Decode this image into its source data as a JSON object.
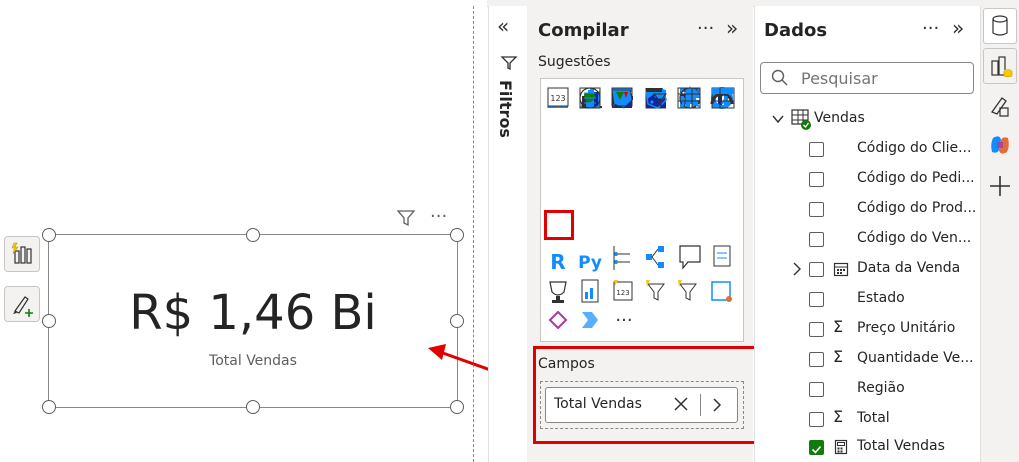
{
  "card": {
    "value": "R$ 1,46 Bi",
    "label": "Total Vendas"
  },
  "filters": {
    "label": "Filtros"
  },
  "build": {
    "title": "Compilar",
    "suggestions_label": "Sugestões",
    "fields_label": "Campos",
    "field_value": "Total Vendas",
    "selected_visual": "card-visual"
  },
  "data_pane": {
    "title": "Dados",
    "search_placeholder": "Pesquisar",
    "table_name": "Vendas",
    "fields": [
      {
        "label": "Código do Clie...",
        "type": "text",
        "checked": false
      },
      {
        "label": "Código do Pedi...",
        "type": "text",
        "checked": false
      },
      {
        "label": "Código do Prod...",
        "type": "text",
        "checked": false
      },
      {
        "label": "Código do Ven...",
        "type": "text",
        "checked": false
      },
      {
        "label": "Data da Venda",
        "type": "date",
        "checked": false
      },
      {
        "label": "Estado",
        "type": "text",
        "checked": false
      },
      {
        "label": "Preço Unitário",
        "type": "sum",
        "checked": false
      },
      {
        "label": "Quantidade Ve...",
        "type": "sum",
        "checked": false
      },
      {
        "label": "Região",
        "type": "text",
        "checked": false
      },
      {
        "label": "Total",
        "type": "sum",
        "checked": false
      },
      {
        "label": "Total Vendas",
        "type": "measure",
        "checked": true
      }
    ]
  },
  "colors": {
    "highlight": "#e00000",
    "accent": "#118dff",
    "check": "#107c10"
  },
  "more_glyph": "···"
}
